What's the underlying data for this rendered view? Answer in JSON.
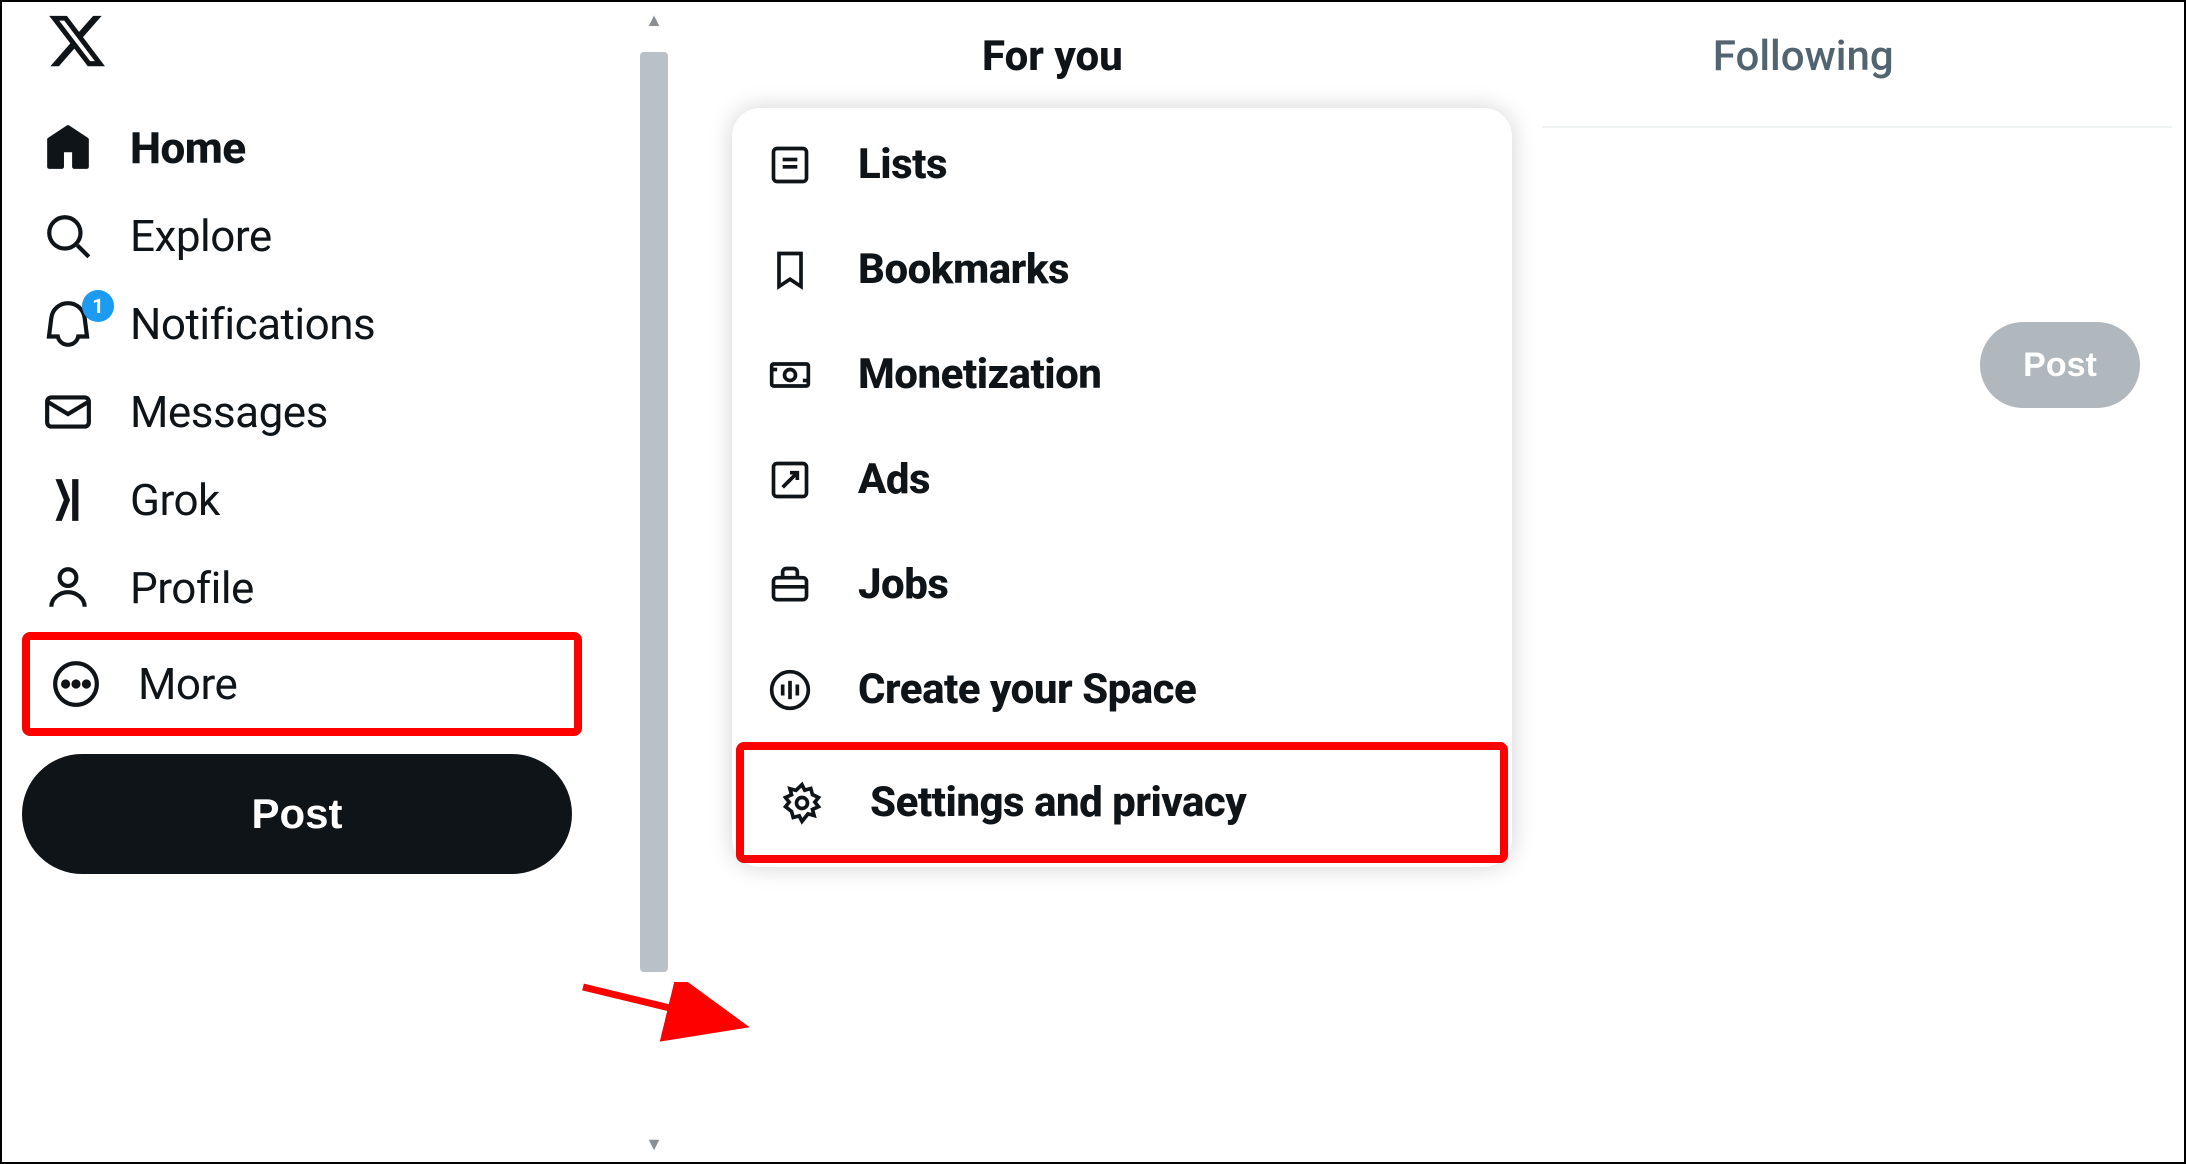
{
  "sidebar": {
    "items": [
      {
        "id": "home",
        "label": "Home",
        "active": true
      },
      {
        "id": "explore",
        "label": "Explore"
      },
      {
        "id": "notifications",
        "label": "Notifications",
        "badge": "1"
      },
      {
        "id": "messages",
        "label": "Messages"
      },
      {
        "id": "grok",
        "label": "Grok"
      },
      {
        "id": "profile",
        "label": "Profile"
      },
      {
        "id": "more",
        "label": "More",
        "highlighted": true
      }
    ],
    "post_label": "Post"
  },
  "tabs": {
    "for_you": "For you",
    "following": "Following"
  },
  "more_menu": {
    "items": [
      {
        "id": "lists",
        "label": "Lists"
      },
      {
        "id": "bookmarks",
        "label": "Bookmarks"
      },
      {
        "id": "monetization",
        "label": "Monetization"
      },
      {
        "id": "ads",
        "label": "Ads"
      },
      {
        "id": "jobs",
        "label": "Jobs"
      },
      {
        "id": "create-space",
        "label": "Create your Space"
      },
      {
        "id": "settings-privacy",
        "label": "Settings and privacy",
        "highlighted": true
      }
    ]
  },
  "mini_post_label": "Post",
  "notification_count": "1"
}
